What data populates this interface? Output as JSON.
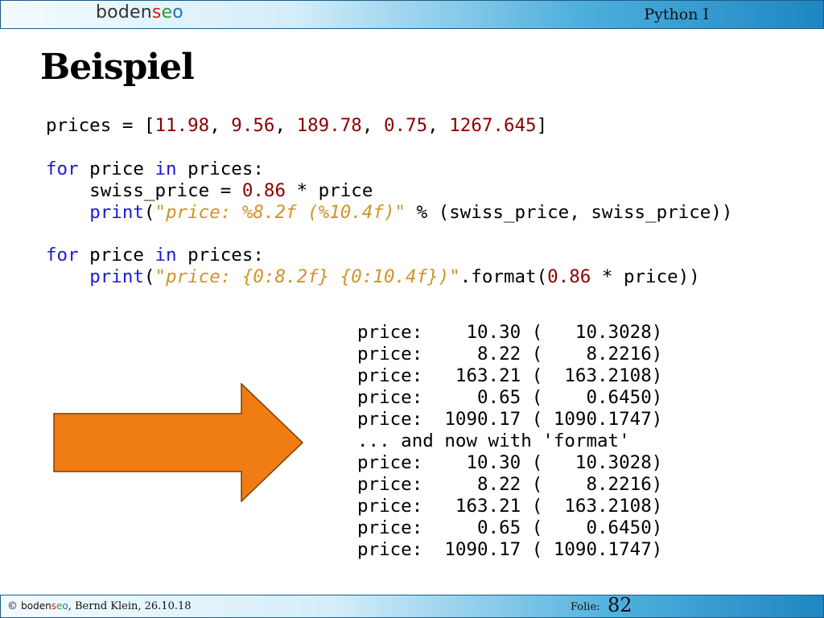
{
  "header": {
    "logo": {
      "part1": "boden",
      "s": "s",
      "e": "e",
      "o": "o"
    },
    "course": "Python I"
  },
  "slide": {
    "title": "Beispiel",
    "code": {
      "line1": [
        "prices = [",
        "11.98",
        ", ",
        "9.56",
        ", ",
        "189.78",
        ", ",
        "0.75",
        ", ",
        "1267.645",
        "]"
      ],
      "loop1": {
        "kw_for": "for",
        "var": " price ",
        "kw_in": "in",
        "iter": " prices:",
        "assign_lhs": "    swiss_price = ",
        "factor": "0.86",
        "assign_rhs": " * price",
        "indent": "    ",
        "print_kw": "print",
        "open": "(",
        "fmt_string": "\"price: %8.2f (%10.4f)\"",
        "rest": " % (swiss_price, swiss_price))"
      },
      "loop2": {
        "kw_for": "for",
        "var": " price ",
        "kw_in": "in",
        "iter": " prices:",
        "indent": "    ",
        "print_kw": "print",
        "open": "(",
        "fmt_string": "\"price: {0:8.2f} {0:10.4f})\"",
        "method": ".format(",
        "factor": "0.86",
        "rest": " * price))"
      }
    },
    "output": [
      "price:    10.30 (   10.3028)",
      "price:     8.22 (    8.2216)",
      "price:   163.21 (  163.2108)",
      "price:     0.65 (    0.6450)",
      "price:  1090.17 ( 1090.1747)",
      "... and now with 'format'",
      "price:    10.30 (   10.3028)",
      "price:     8.22 (    8.2216)",
      "price:   163.21 (  163.2108)",
      "price:     0.65 (    0.6450)",
      "price:  1090.17 ( 1090.1747)"
    ],
    "arrow_color": "#f07c14"
  },
  "footer": {
    "copyright": "© ",
    "brand": {
      "part1": "boden",
      "s": "s",
      "e": "e",
      "o": "o"
    },
    "author_date": ", Bernd Klein, 26.10.18",
    "folie_label": "Folie:",
    "folie_number": "82"
  },
  "colors": {
    "keyword": "#1a1ad8",
    "number": "#8b0000",
    "string": "#d2922a",
    "bar_dark": "#1e86c2"
  }
}
